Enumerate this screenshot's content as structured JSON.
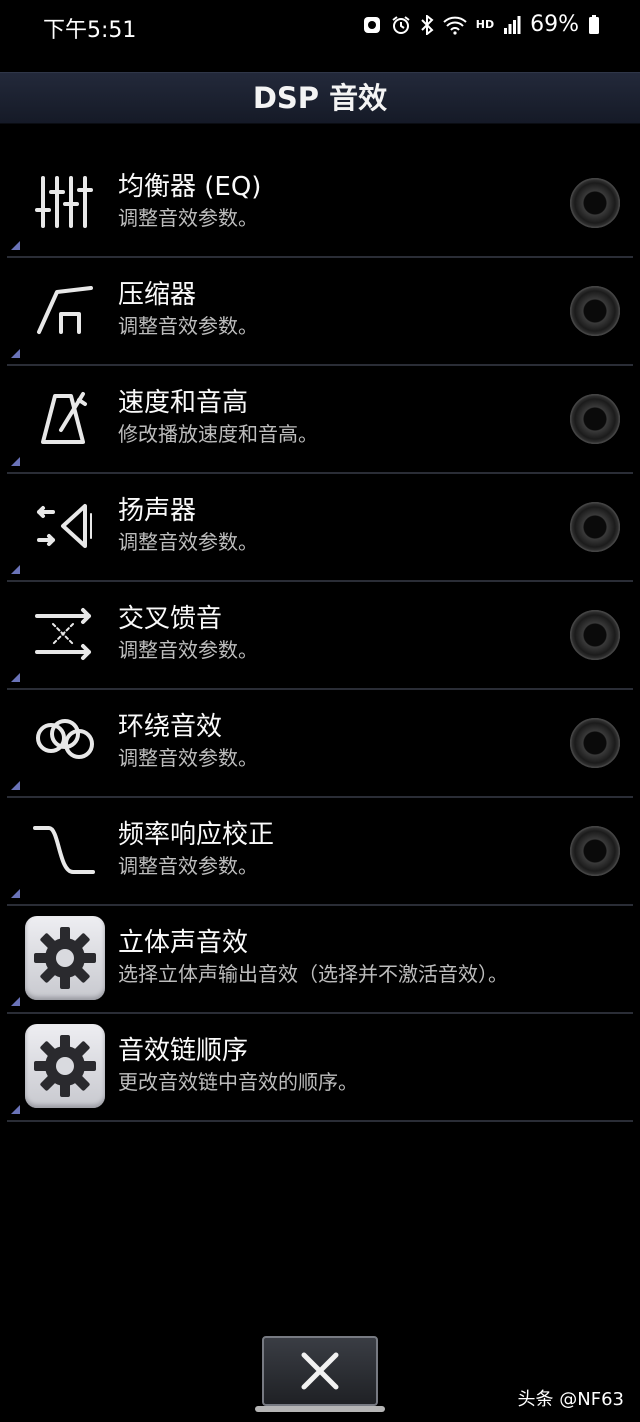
{
  "status_bar": {
    "time": "下午5:51",
    "network": "HD",
    "battery": "69%"
  },
  "header": {
    "title": "DSP 音效"
  },
  "items": [
    {
      "title": "均衡器 (EQ)",
      "subtitle": "调整音效参数。",
      "icon": "equalizer-icon",
      "control": "radio"
    },
    {
      "title": "压缩器",
      "subtitle": "调整音效参数。",
      "icon": "compressor-icon",
      "control": "radio"
    },
    {
      "title": "速度和音高",
      "subtitle": "修改播放速度和音高。",
      "icon": "metronome-icon",
      "control": "radio"
    },
    {
      "title": "扬声器",
      "subtitle": "调整音效参数。",
      "icon": "speaker-icon",
      "control": "radio"
    },
    {
      "title": "交叉馈音",
      "subtitle": "调整音效参数。",
      "icon": "crossfeed-icon",
      "control": "radio"
    },
    {
      "title": "环绕音效",
      "subtitle": "调整音效参数。",
      "icon": "surround-icon",
      "control": "radio"
    },
    {
      "title": "频率响应校正",
      "subtitle": "调整音效参数。",
      "icon": "frequency-response-icon",
      "control": "radio"
    },
    {
      "title": "立体声音效",
      "subtitle": "选择立体声输出音效（选择并不激活音效）。",
      "icon": "gear-icon",
      "control": "none"
    },
    {
      "title": "音效链顺序",
      "subtitle": "更改音效链中音效的顺序。",
      "icon": "gear-icon",
      "control": "none"
    }
  ],
  "watermark": "头条 @NF63",
  "colors": {
    "background": "#000000",
    "titlebar": "#1c2130",
    "corner_marker": "#6a73b8"
  }
}
